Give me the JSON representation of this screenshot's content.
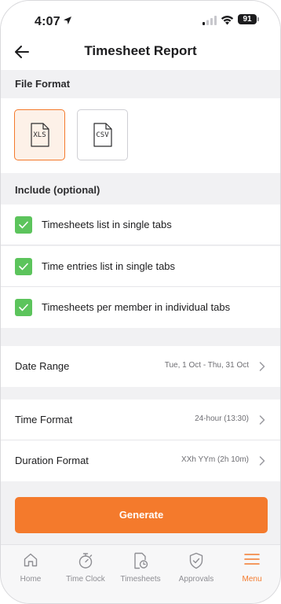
{
  "status_bar": {
    "time": "4:07",
    "battery": "91"
  },
  "header": {
    "title": "Timesheet Report"
  },
  "file_format": {
    "heading": "File Format",
    "options": [
      {
        "label": "XLS",
        "selected": true
      },
      {
        "label": "CSV",
        "selected": false
      }
    ]
  },
  "include": {
    "heading": "Include (optional)",
    "items": [
      {
        "label": "Timesheets list in single tabs",
        "checked": true
      },
      {
        "label": "Time entries list in single tabs",
        "checked": true
      },
      {
        "label": "Timesheets per member in individual tabs",
        "checked": true
      }
    ]
  },
  "settings": {
    "date_range": {
      "label": "Date Range",
      "value": "Tue, 1 Oct - Thu, 31 Oct"
    },
    "time_format": {
      "label": "Time Format",
      "value": "24-hour (13:30)"
    },
    "duration_format": {
      "label": "Duration Format",
      "value": "XXh YYm (2h 10m)"
    }
  },
  "generate": {
    "label": "Generate"
  },
  "tabs": [
    {
      "label": "Home",
      "icon": "home-icon",
      "active": false
    },
    {
      "label": "Time Clock",
      "icon": "stopwatch-icon",
      "active": false
    },
    {
      "label": "Timesheets",
      "icon": "timesheet-icon",
      "active": false
    },
    {
      "label": "Approvals",
      "icon": "shield-check-icon",
      "active": false
    },
    {
      "label": "Menu",
      "icon": "hamburger-menu-icon",
      "active": true
    }
  ],
  "colors": {
    "accent": "#f47a2c",
    "checkbox": "#5cc45c",
    "background": "#f1f1f3"
  }
}
